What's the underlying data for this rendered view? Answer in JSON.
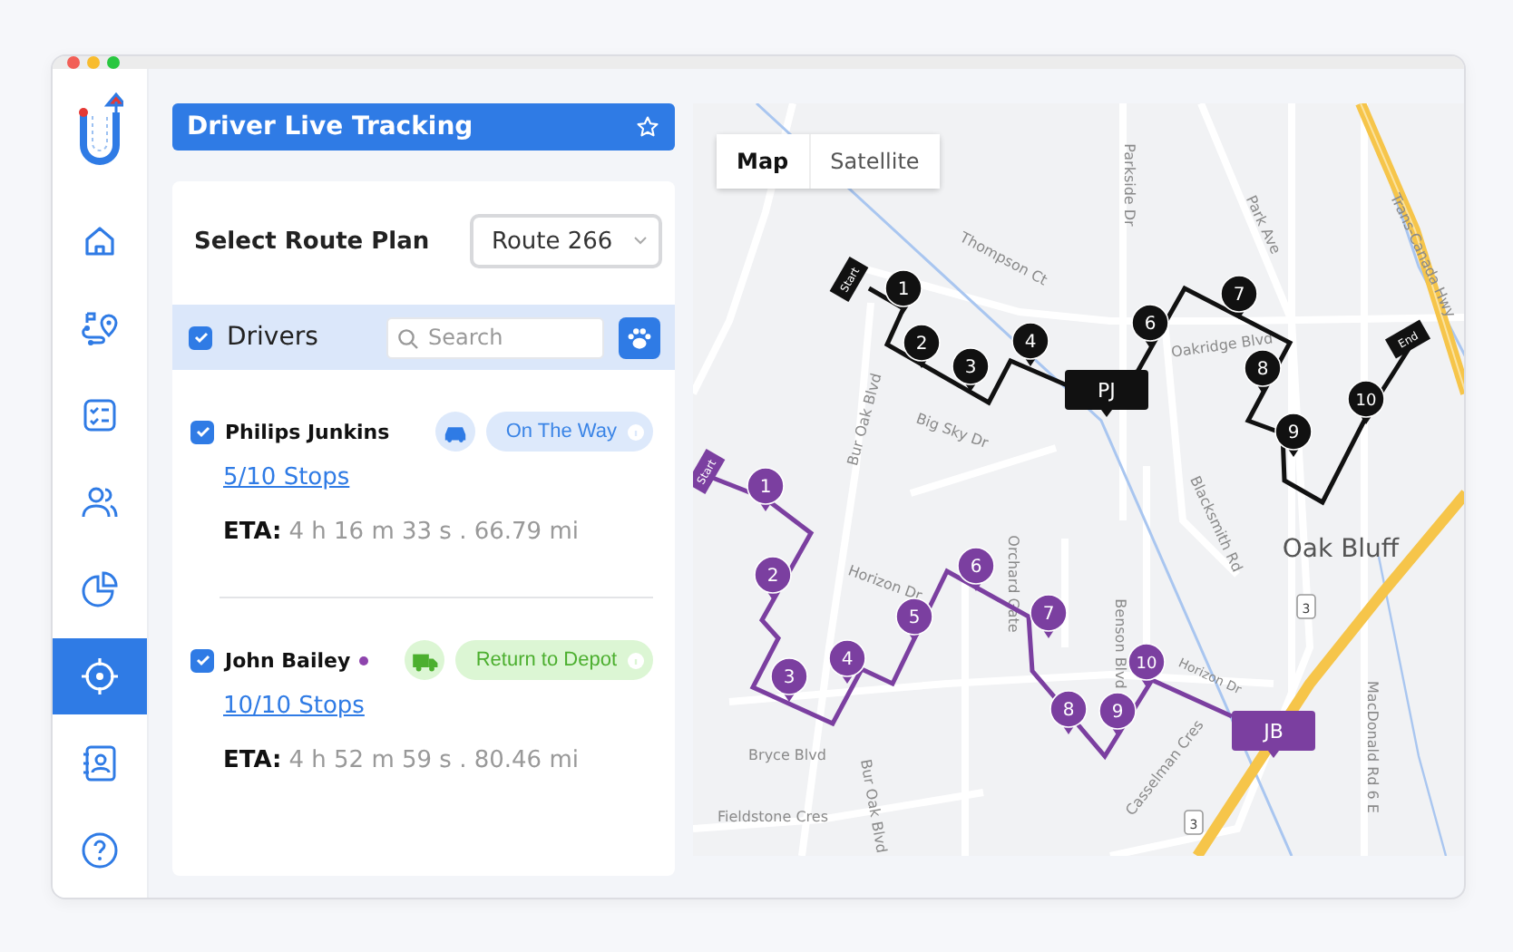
{
  "nav": [
    {
      "kind": "home",
      "selected": false
    },
    {
      "kind": "route",
      "selected": false
    },
    {
      "kind": "checklist",
      "selected": false
    },
    {
      "kind": "users",
      "selected": false
    },
    {
      "kind": "chart",
      "selected": false
    },
    {
      "kind": "tracking",
      "selected": true
    },
    {
      "kind": "contacts",
      "selected": false
    },
    {
      "kind": "help",
      "selected": false
    }
  ],
  "header": {
    "title": "Driver Live Tracking"
  },
  "route_plan": {
    "label": "Select Route Plan",
    "value": "Route 266"
  },
  "drivers_bar": {
    "label": "Drivers",
    "checked": true,
    "placeholder": "Search"
  },
  "drivers": [
    {
      "name": "Philips Junkins",
      "checked": true,
      "kind": "car",
      "status": "On The Way",
      "stops": "5/10 Stops",
      "eta_label": "ETA:",
      "eta": "4 h 16 m 33 s . 66.79 mi"
    },
    {
      "name": "John Bailey",
      "checked": true,
      "color": "#8e44ad",
      "kind": "truck",
      "status": "Return to Depot",
      "stops": "10/10 Stops",
      "eta_label": "ETA:",
      "eta": "4 h 52 m 59 s . 80.46 mi"
    }
  ],
  "map": {
    "types": [
      {
        "label": "Map",
        "selected": true
      },
      {
        "label": "Satellite",
        "selected": false
      }
    ],
    "labels": [
      "Thompson Ct",
      "Parkside Dr",
      "Park Ave",
      "Trans-Canada Hwy",
      "Oakridge Blvd",
      "Bur Oak Blvd",
      "Big Sky Dr",
      "Horizon Dr",
      "Horizon Dr",
      "Orchard Gate",
      "Benson Blvd",
      "Blacksmith Rd",
      "Oak Bluff",
      "Casselman Cres",
      "Bryce Blvd",
      "Fieldstone Cres",
      "Bur Oak Blvd",
      "MacDonald Rd 6 E"
    ],
    "shields": [
      "3",
      "3"
    ],
    "routes": [
      {
        "driver": "PJ",
        "color": "#111111",
        "start": "Start",
        "end": "End",
        "stops": [
          "1",
          "2",
          "3",
          "4",
          "6",
          "7",
          "8",
          "9",
          "10"
        ]
      },
      {
        "driver": "JB",
        "color": "#7b3fa0",
        "start": "Start",
        "stops": [
          "1",
          "2",
          "3",
          "4",
          "5",
          "6",
          "7",
          "8",
          "9",
          "10"
        ]
      }
    ]
  }
}
